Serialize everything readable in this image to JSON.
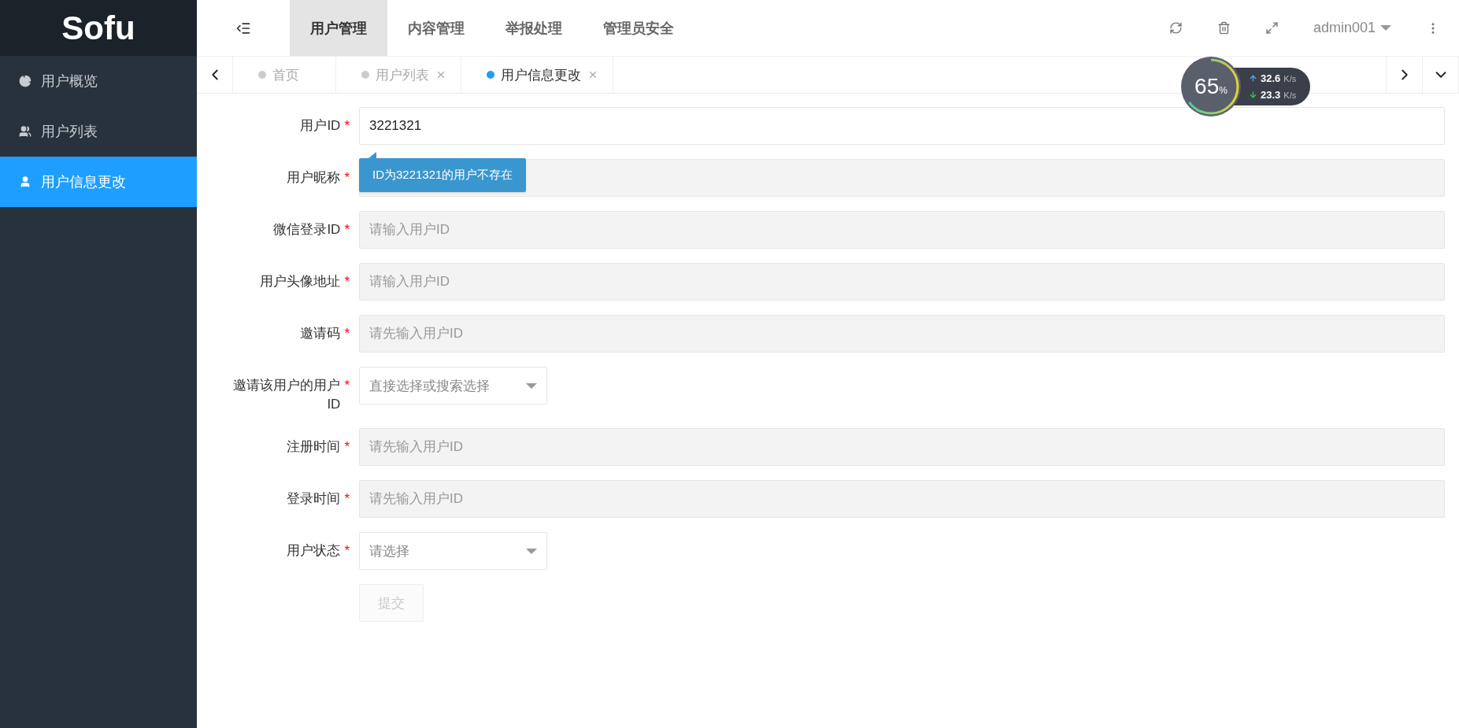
{
  "logo": "Sofu",
  "sidebar": {
    "items": [
      {
        "label": "用户概览",
        "selected": false
      },
      {
        "label": "用户列表",
        "selected": false
      },
      {
        "label": "用户信息更改",
        "selected": true
      }
    ]
  },
  "top_nav": {
    "items": [
      {
        "label": "用户管理",
        "selected": true
      },
      {
        "label": "内容管理",
        "selected": false
      },
      {
        "label": "举报处理",
        "selected": false
      },
      {
        "label": "管理员安全",
        "selected": false
      }
    ],
    "user": "admin001"
  },
  "page_tabs": [
    {
      "label": "首页",
      "selected": false,
      "closable": false
    },
    {
      "label": "用户列表",
      "selected": false,
      "closable": true
    },
    {
      "label": "用户信息更改",
      "selected": true,
      "closable": true
    }
  ],
  "form": {
    "fields": [
      {
        "kind": "text",
        "label": "用户ID",
        "mark": "*",
        "value": "3221321",
        "disabled": false
      },
      {
        "kind": "text",
        "label": "用户昵称",
        "mark": "*",
        "disabled": true
      },
      {
        "kind": "text",
        "label": "微信登录ID",
        "mark": "*",
        "placeholder": "请输入用户ID",
        "disabled": true
      },
      {
        "kind": "text",
        "label": "用户头像地址",
        "mark": "*",
        "placeholder": "请输入用户ID",
        "disabled": true
      },
      {
        "kind": "text",
        "label": "邀请码",
        "mark": "*",
        "placeholder": "请先输入用户ID",
        "disabled": true
      },
      {
        "kind": "select",
        "label": "邀请该用户的用户ID",
        "mark": "*",
        "placeholder": "直接选择或搜索选择"
      },
      {
        "kind": "text",
        "label": "注册时间",
        "mark": "*",
        "placeholder": "请先输入用户ID",
        "disabled": true
      },
      {
        "kind": "text",
        "label": "登录时间",
        "mark": "*",
        "placeholder": "请先输入用户ID",
        "disabled": true
      },
      {
        "kind": "select",
        "label": "用户状态",
        "mark": "*",
        "placeholder": "请选择"
      }
    ],
    "tooltip": "ID为3221321的用户不存在",
    "submit": {
      "label": "提交",
      "disabled": true
    }
  },
  "net_monitor": {
    "percent": "65",
    "unit": "%",
    "level": 0.65,
    "upload": "32.6",
    "upload_unit": "K/s",
    "download": "23.3",
    "download_unit": "K/s"
  }
}
